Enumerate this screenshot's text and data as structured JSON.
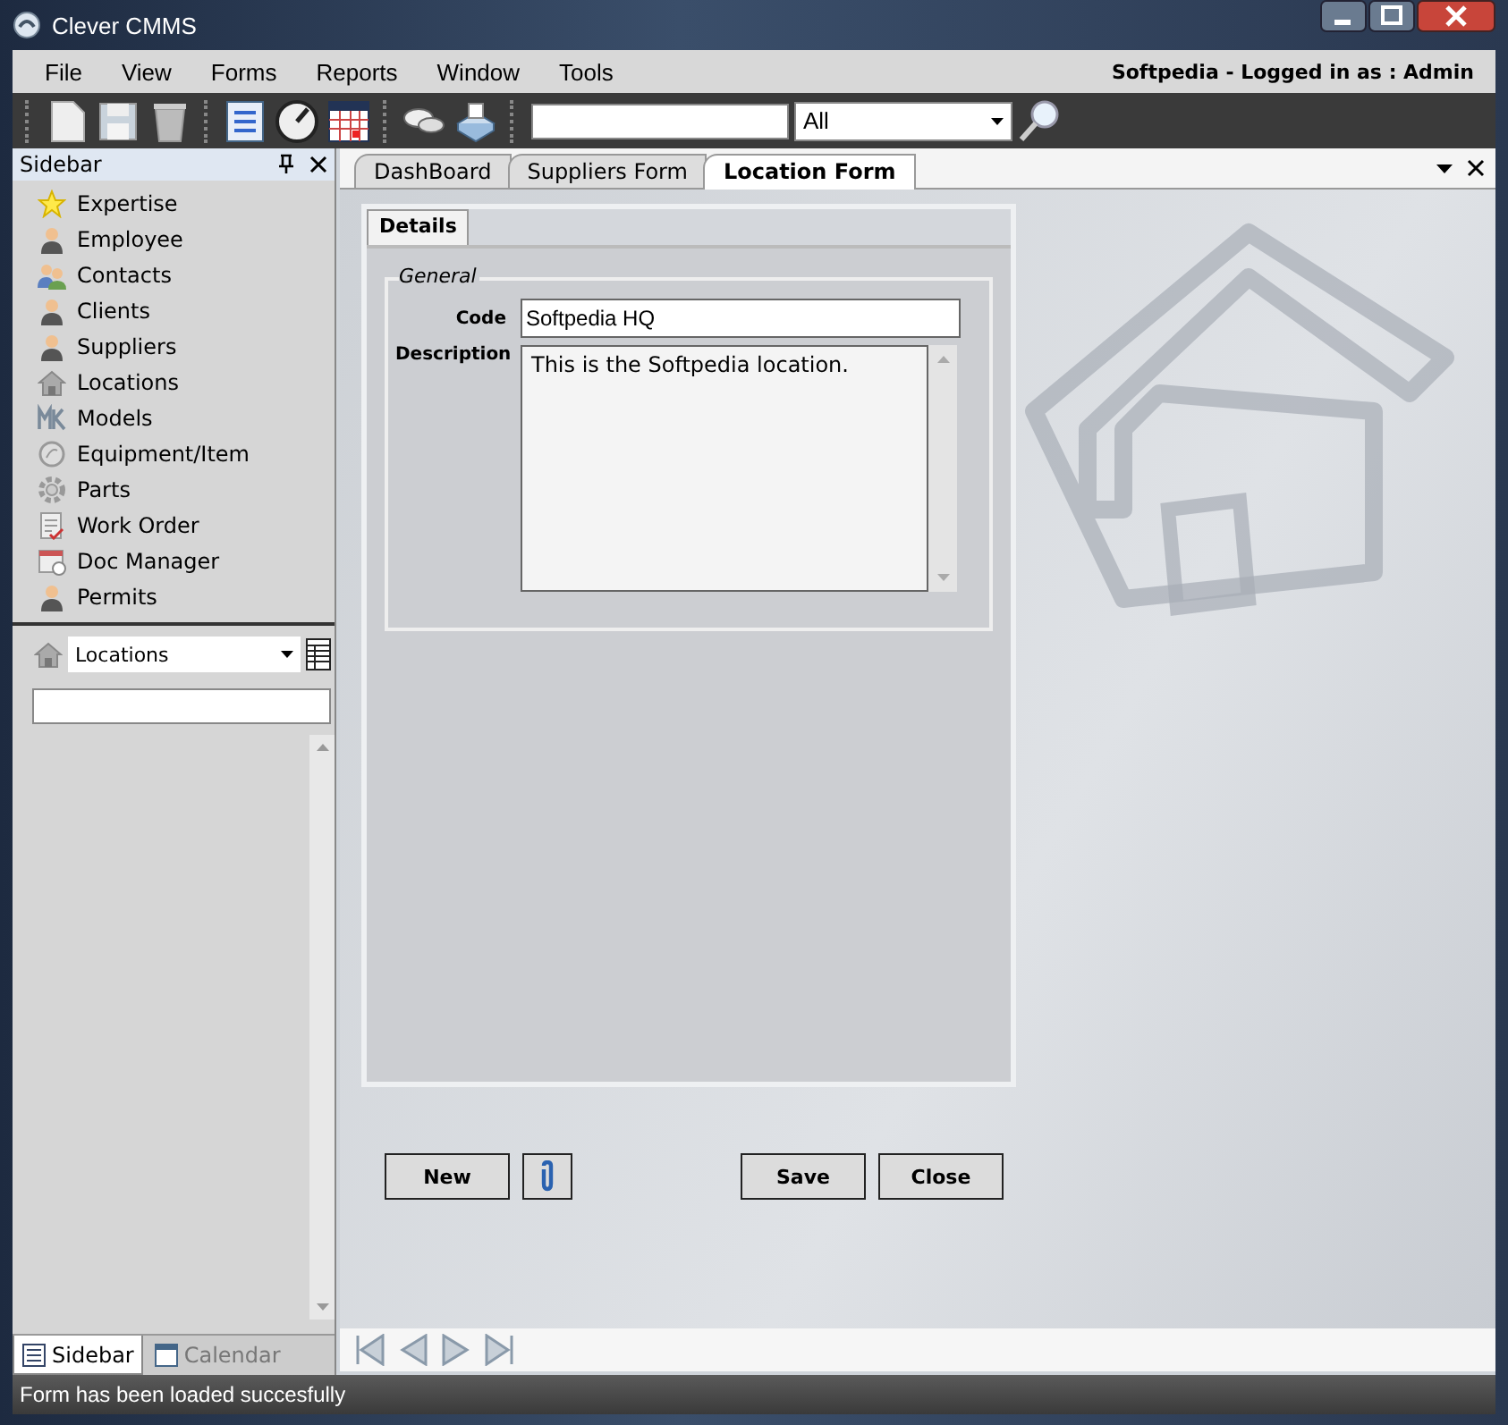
{
  "window": {
    "title": "Clever CMMS"
  },
  "menu": [
    "File",
    "View",
    "Forms",
    "Reports",
    "Window",
    "Tools"
  ],
  "login_text": "Softpedia - Logged in as :  Admin",
  "toolbar": {
    "filter_value": "All"
  },
  "sidebar": {
    "title": "Sidebar",
    "items": [
      {
        "label": "Expertise",
        "kind": "star"
      },
      {
        "label": "Employee",
        "kind": "person"
      },
      {
        "label": "Contacts",
        "kind": "people"
      },
      {
        "label": "Clients",
        "kind": "person"
      },
      {
        "label": "Suppliers",
        "kind": "person"
      },
      {
        "label": "Locations",
        "kind": "house"
      },
      {
        "label": "Models",
        "kind": "mk"
      },
      {
        "label": "Equipment/Item",
        "kind": "circle"
      },
      {
        "label": "Parts",
        "kind": "gear"
      },
      {
        "label": "Work Order",
        "kind": "doc"
      },
      {
        "label": "Doc Manager",
        "kind": "calendar"
      },
      {
        "label": "Permits",
        "kind": "person"
      }
    ],
    "category_select": "Locations",
    "bottom_tabs": [
      {
        "label": "Sidebar",
        "selected": true
      },
      {
        "label": "Calendar",
        "selected": false
      }
    ]
  },
  "doc_tabs": [
    {
      "label": "DashBoard",
      "selected": false
    },
    {
      "label": "Suppliers Form",
      "selected": false
    },
    {
      "label": "Location Form",
      "selected": true
    }
  ],
  "form": {
    "tab": "Details",
    "group": "General",
    "code_label": "Code",
    "code_value": "Softpedia HQ",
    "description_label": "Description",
    "description_value": "This is the Softpedia location."
  },
  "buttons": {
    "new": "New",
    "save": "Save",
    "close": "Close"
  },
  "status_bar": "Form has been loaded succesfully"
}
